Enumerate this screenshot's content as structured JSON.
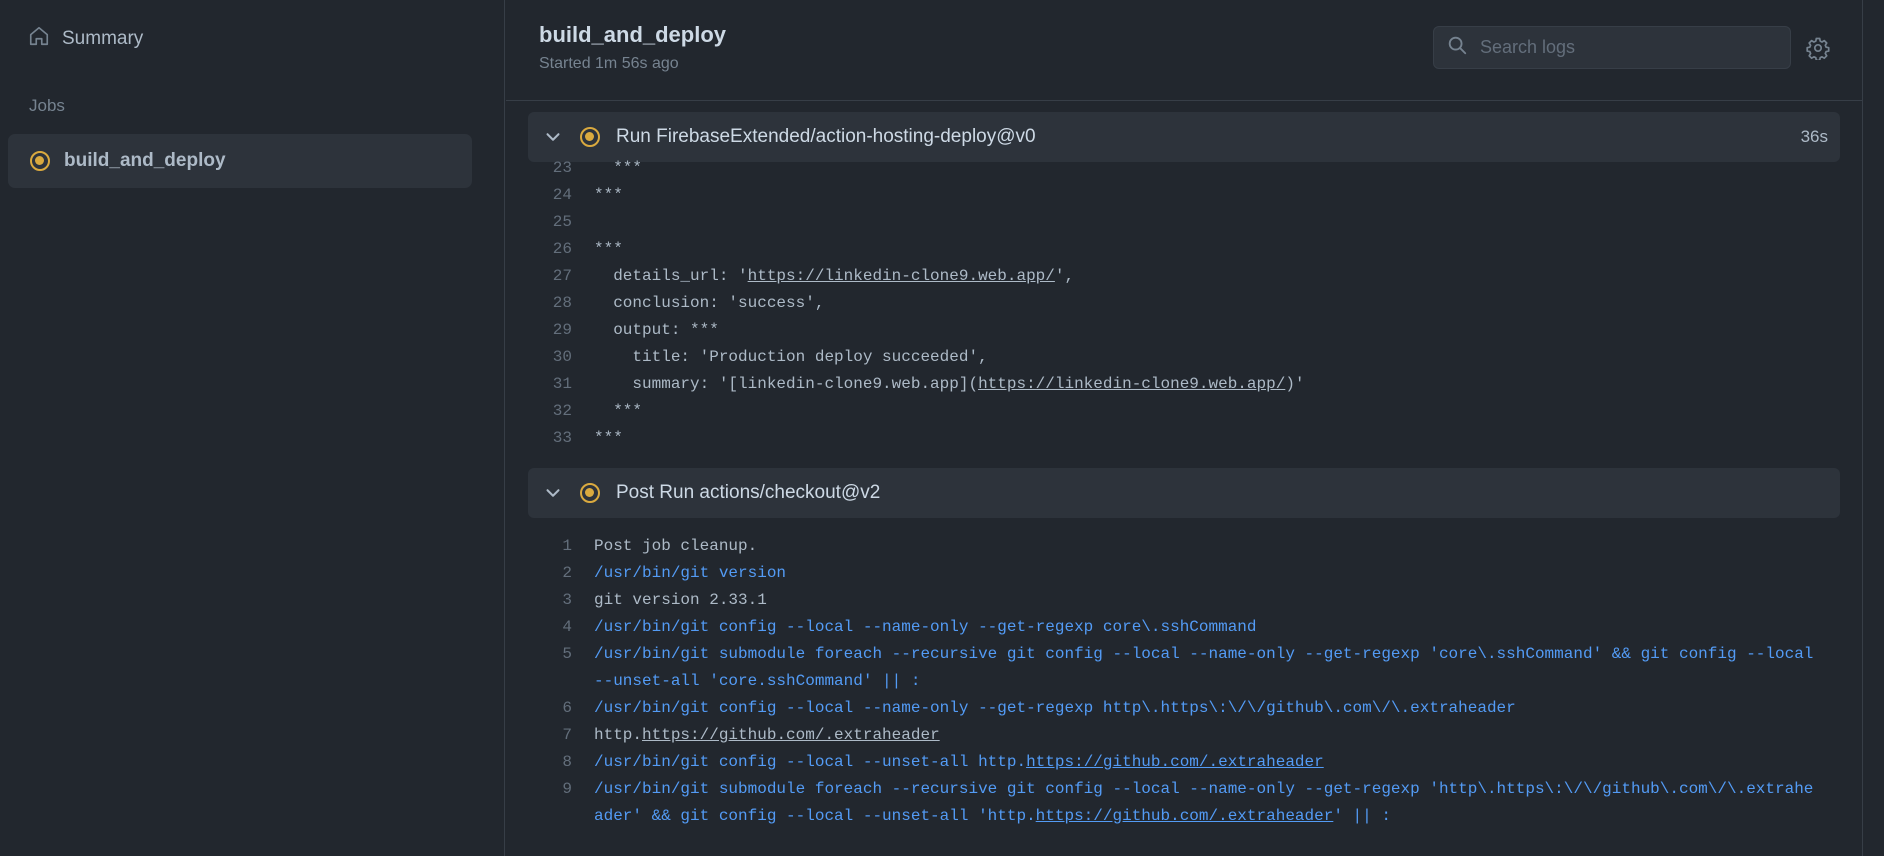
{
  "sidebar": {
    "summary_label": "Summary",
    "jobs_heading": "Jobs",
    "jobs": [
      {
        "label": "build_and_deploy",
        "status": "in-progress"
      }
    ]
  },
  "header": {
    "title": "build_and_deploy",
    "subtitle": "Started 1m 56s ago",
    "search_placeholder": "Search logs"
  },
  "steps": [
    {
      "name": "Run FirebaseExtended/action-hosting-deploy@v0",
      "duration": "36s",
      "lines": [
        {
          "n": "23",
          "segments": [
            {
              "t": "  ***"
            }
          ]
        },
        {
          "n": "24",
          "segments": [
            {
              "t": "***"
            }
          ]
        },
        {
          "n": "25",
          "segments": [
            {
              "t": ""
            }
          ]
        },
        {
          "n": "26",
          "segments": [
            {
              "t": "***"
            }
          ]
        },
        {
          "n": "27",
          "segments": [
            {
              "t": "  details_url: '"
            },
            {
              "t": "https://linkedin-clone9.web.app/",
              "link": true
            },
            {
              "t": "',"
            }
          ]
        },
        {
          "n": "28",
          "segments": [
            {
              "t": "  conclusion: 'success',"
            }
          ]
        },
        {
          "n": "29",
          "segments": [
            {
              "t": "  output: ***"
            }
          ]
        },
        {
          "n": "30",
          "segments": [
            {
              "t": "    title: 'Production deploy succeeded',"
            }
          ]
        },
        {
          "n": "31",
          "segments": [
            {
              "t": "    summary: '[linkedin-clone9.web.app]("
            },
            {
              "t": "https://linkedin-clone9.web.app/",
              "link": true
            },
            {
              "t": ")'"
            }
          ]
        },
        {
          "n": "32",
          "segments": [
            {
              "t": "  ***"
            }
          ]
        },
        {
          "n": "33",
          "segments": [
            {
              "t": "***"
            }
          ]
        }
      ]
    },
    {
      "name": "Post Run actions/checkout@v2",
      "duration": "",
      "lines": [
        {
          "n": "1",
          "segments": [
            {
              "t": "Post job cleanup."
            }
          ]
        },
        {
          "n": "2",
          "cmd": true,
          "segments": [
            {
              "t": "/usr/bin/git version"
            }
          ]
        },
        {
          "n": "3",
          "segments": [
            {
              "t": "git version 2.33.1"
            }
          ]
        },
        {
          "n": "4",
          "cmd": true,
          "segments": [
            {
              "t": "/usr/bin/git config --local --name-only --get-regexp core\\.sshCommand"
            }
          ]
        },
        {
          "n": "5",
          "cmd": true,
          "segments": [
            {
              "t": "/usr/bin/git submodule foreach --recursive git config --local --name-only --get-regexp 'core\\.sshCommand' && git config --local --unset-all 'core.sshCommand' || :"
            }
          ]
        },
        {
          "n": "6",
          "cmd": true,
          "segments": [
            {
              "t": "/usr/bin/git config --local --name-only --get-regexp http\\.https\\:\\/\\/github\\.com\\/\\.extraheader"
            }
          ]
        },
        {
          "n": "7",
          "segments": [
            {
              "t": "http."
            },
            {
              "t": "https://github.com/.extraheader",
              "link": true
            }
          ]
        },
        {
          "n": "8",
          "cmd": true,
          "segments": [
            {
              "t": "/usr/bin/git config --local --unset-all http."
            },
            {
              "t": "https://github.com/.extraheader",
              "link": true
            }
          ]
        },
        {
          "n": "9",
          "cmd": true,
          "segments": [
            {
              "t": "/usr/bin/git submodule foreach --recursive git config --local --name-only --get-regexp 'http\\.https\\:\\/\\/github\\.com\\/\\.extraheader' && git config --local --unset-all 'http."
            },
            {
              "t": "https://github.com/.extraheader",
              "link": true
            },
            {
              "t": "' || :"
            }
          ]
        }
      ]
    }
  ],
  "icons": {
    "summary": "home-icon",
    "search": "search-icon",
    "settings": "gear-icon",
    "expand": "chevron-down-icon",
    "status": "in-progress-status-icon"
  },
  "colors": {
    "background": "#22272e",
    "panel": "#2d333b",
    "status": "#daaa3f",
    "command": "#539bf5"
  }
}
